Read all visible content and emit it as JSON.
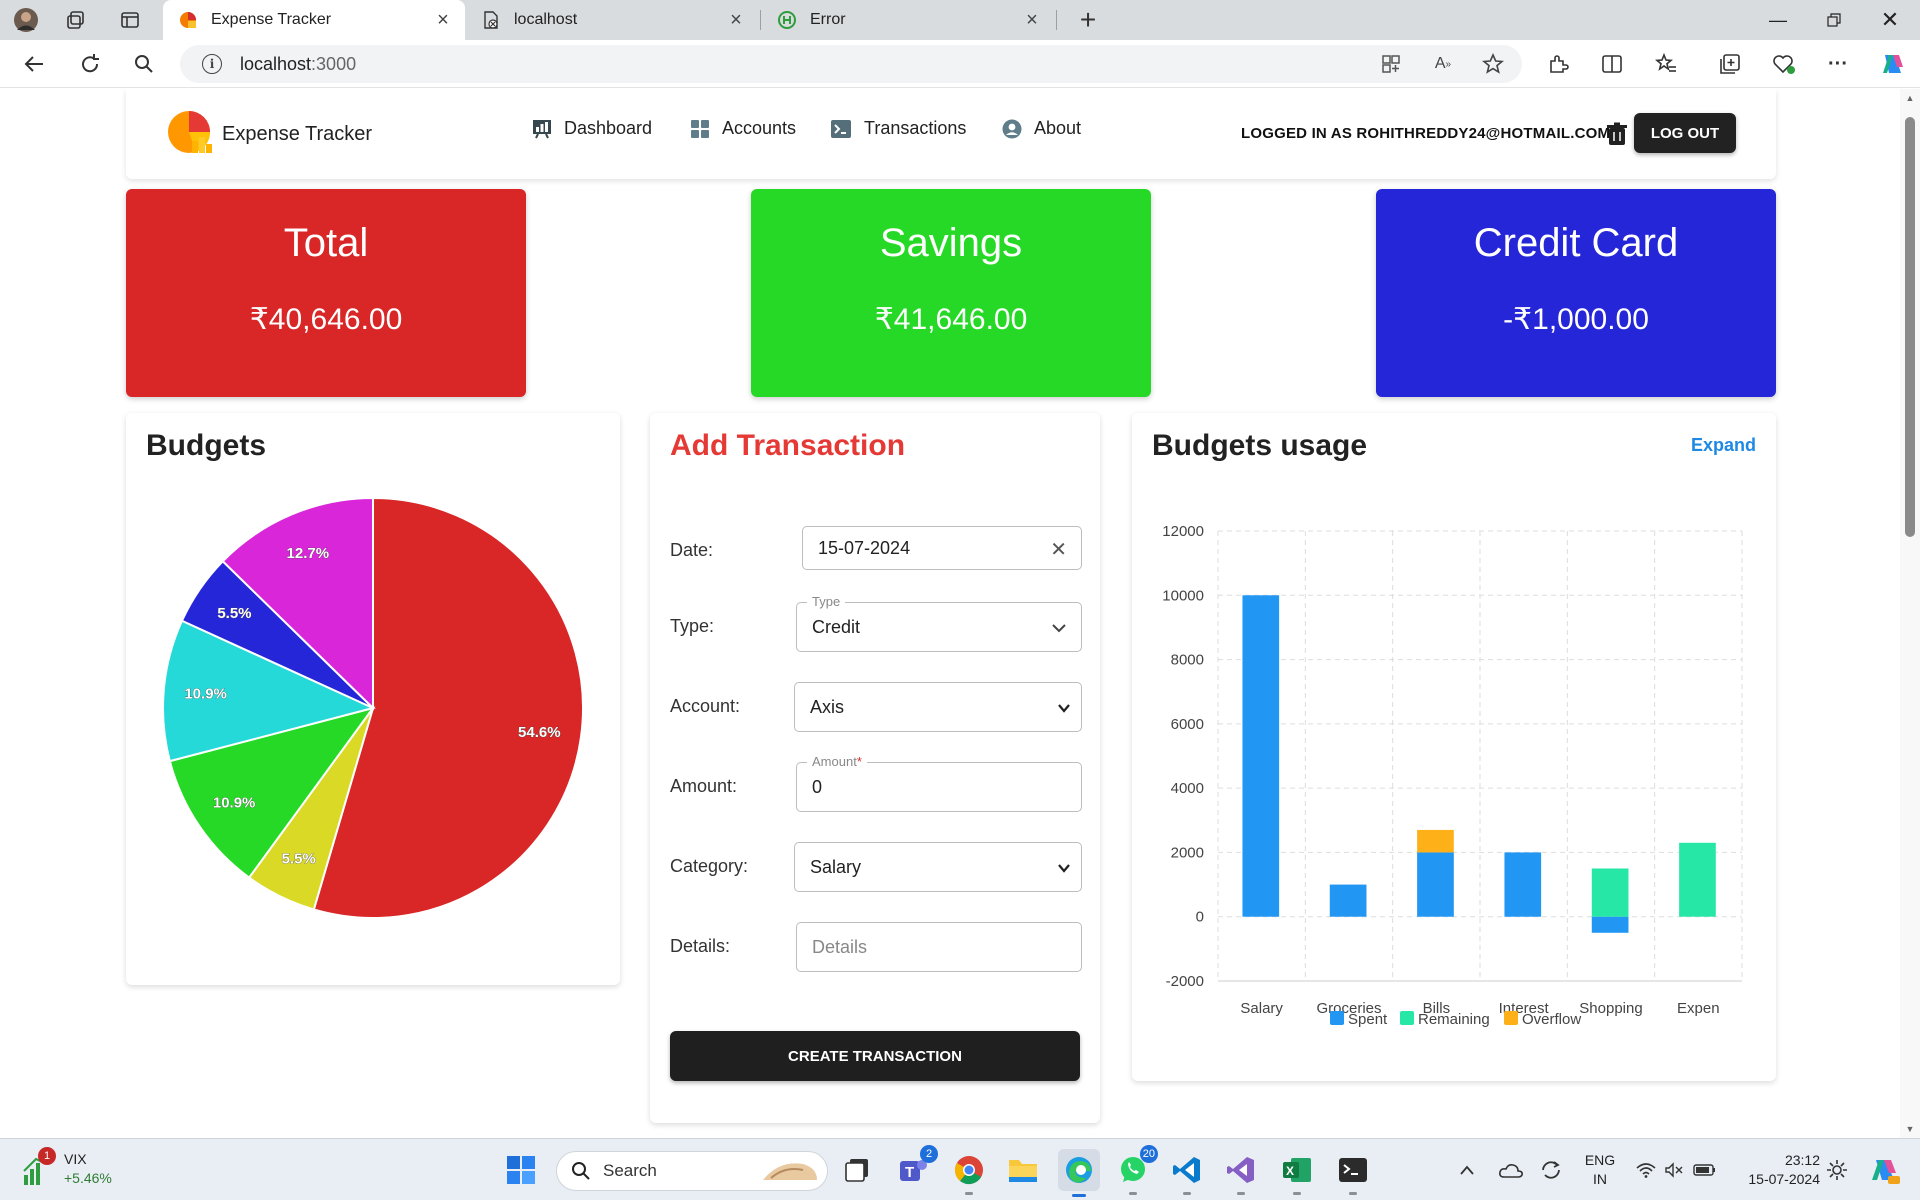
{
  "browser": {
    "tabs": [
      {
        "title": "Expense Tracker",
        "active": true
      },
      {
        "title": "localhost",
        "active": false
      },
      {
        "title": "Error",
        "active": false
      }
    ],
    "url_host": "localhost",
    "url_port": ":3000"
  },
  "app": {
    "brand": "Expense Tracker",
    "nav": [
      {
        "label": "Dashboard",
        "icon": "dashboard-icon"
      },
      {
        "label": "Accounts",
        "icon": "grid-icon"
      },
      {
        "label": "Transactions",
        "icon": "terminal-icon"
      },
      {
        "label": "About",
        "icon": "user-circle-icon"
      }
    ],
    "logged_in": "LOGGED IN AS ROHITHREDDY24@HOTMAIL.COM",
    "logout": "LOG OUT"
  },
  "accounts": [
    {
      "name": "Total",
      "value": "₹40,646.00",
      "color": "#d92626"
    },
    {
      "name": "Savings",
      "value": "₹41,646.00",
      "color": "#26d926"
    },
    {
      "name": "Credit Card",
      "value": "-₹1,000.00",
      "color": "#2626d9"
    }
  ],
  "budgets": {
    "title": "Budgets"
  },
  "form": {
    "title": "Add Transaction",
    "title_color": "#e53935",
    "date_label": "Date:",
    "date_value": "15-07-2024",
    "type_label": "Type:",
    "type_legend": "Type",
    "type_value": "Credit",
    "account_label": "Account:",
    "account_value": "Axis",
    "amount_label": "Amount:",
    "amount_legend": "Amount",
    "amount_required": "*",
    "amount_value": "0",
    "category_label": "Category:",
    "category_value": "Salary",
    "details_label": "Details:",
    "details_placeholder": "Details",
    "submit": "CREATE TRANSACTION"
  },
  "usage": {
    "title": "Budgets usage",
    "expand": "Expand"
  },
  "chart_data": [
    {
      "type": "pie",
      "title": "Budgets",
      "slices": [
        {
          "label": "54.6%",
          "value": 54.6,
          "color": "#d92626"
        },
        {
          "label": "5.5%",
          "value": 5.5,
          "color": "#d9d926"
        },
        {
          "label": "10.9%",
          "value": 10.9,
          "color": "#26d926"
        },
        {
          "label": "10.9%",
          "value": 10.9,
          "color": "#26d9d9"
        },
        {
          "label": "5.5%",
          "value": 5.5,
          "color": "#2626d9"
        },
        {
          "label": "12.7%",
          "value": 12.7,
          "color": "#d926d9"
        }
      ]
    },
    {
      "type": "bar",
      "title": "Budgets usage",
      "stacked": true,
      "categories": [
        "Salary",
        "Groceries",
        "Bills",
        "Interest",
        "Shopping",
        "Expen"
      ],
      "series": [
        {
          "name": "Spent",
          "color": "#2196f3",
          "values": [
            10000,
            1000,
            2000,
            2000,
            -500,
            0
          ]
        },
        {
          "name": "Remaining",
          "color": "#26e7a6",
          "values": [
            0,
            0,
            0,
            0,
            1500,
            2300
          ]
        },
        {
          "name": "Overflow",
          "color": "#feb019",
          "values": [
            0,
            0,
            700,
            0,
            0,
            0
          ]
        }
      ],
      "ylim": [
        -2000,
        12000
      ],
      "yticks": [
        12000,
        10000,
        8000,
        6000,
        4000,
        2000,
        0,
        -2000
      ],
      "grid": true,
      "legend": "bottom"
    }
  ],
  "taskbar": {
    "widget_name": "VIX",
    "widget_change": "+5.46%",
    "widget_badge": "1",
    "search": "Search",
    "teams_badge": "2",
    "whatsapp_badge": "20",
    "lang_1": "ENG",
    "lang_2": "IN",
    "time": "23:12",
    "date": "15-07-2024"
  }
}
